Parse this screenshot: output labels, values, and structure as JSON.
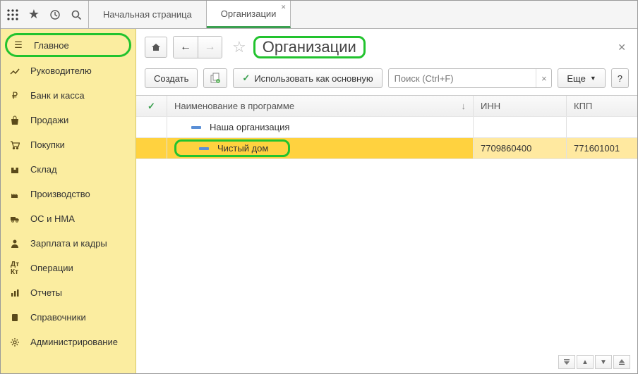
{
  "tabs": [
    {
      "label": "Начальная страница",
      "active": false,
      "closable": false
    },
    {
      "label": "Организации",
      "active": true,
      "closable": true
    }
  ],
  "sidebar": {
    "items": [
      {
        "label": "Главное",
        "active": true
      },
      {
        "label": "Руководителю",
        "active": false
      },
      {
        "label": "Банк и касса",
        "active": false
      },
      {
        "label": "Продажи",
        "active": false
      },
      {
        "label": "Покупки",
        "active": false
      },
      {
        "label": "Склад",
        "active": false
      },
      {
        "label": "Производство",
        "active": false
      },
      {
        "label": "ОС и НМА",
        "active": false
      },
      {
        "label": "Зарплата и кадры",
        "active": false
      },
      {
        "label": "Операции",
        "active": false
      },
      {
        "label": "Отчеты",
        "active": false
      },
      {
        "label": "Справочники",
        "active": false
      },
      {
        "label": "Администрирование",
        "active": false
      }
    ]
  },
  "page": {
    "title": "Организации",
    "create_label": "Создать",
    "use_main_label": "Использовать как основную",
    "search_placeholder": "Поиск (Ctrl+F)",
    "more_label": "Еще",
    "help_label": "?"
  },
  "table": {
    "columns": {
      "name": "Наименование в программе",
      "inn": "ИНН",
      "kpp": "КПП"
    },
    "rows": [
      {
        "name": "Наша организация",
        "inn": "",
        "kpp": "",
        "selected": false,
        "indent": 1
      },
      {
        "name": "Чистый дом",
        "inn": "7709860400",
        "kpp": "771601001",
        "selected": true,
        "indent": 2
      }
    ]
  }
}
